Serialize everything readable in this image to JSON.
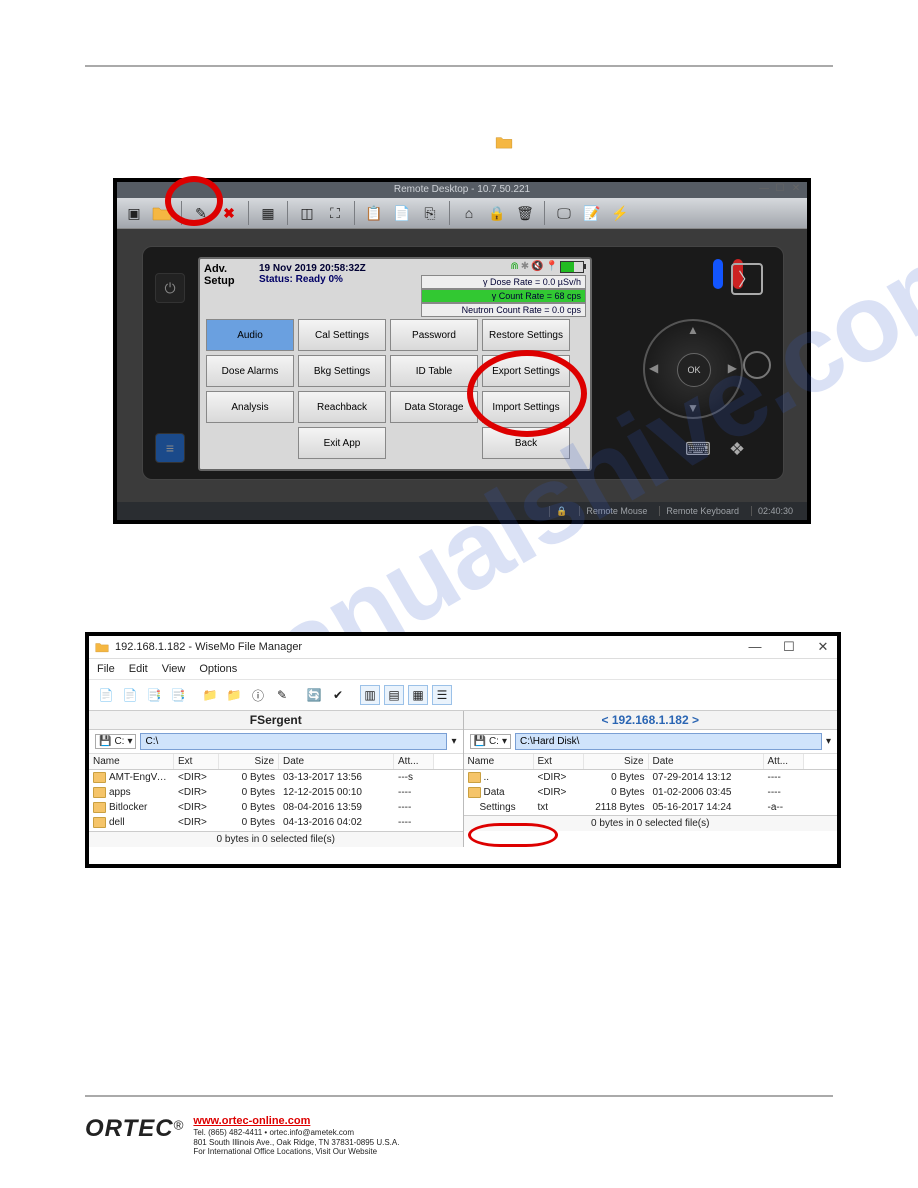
{
  "remote_desktop": {
    "title": "Remote Desktop - 10.7.50.221",
    "footer": {
      "mouse": "Remote Mouse",
      "keyboard": "Remote Keyboard",
      "time": "02:40:30"
    },
    "device": {
      "header": {
        "title_l1": "Adv.",
        "title_l2": "Setup",
        "timestamp": "19 Nov 2019 20:58:32Z",
        "status": "Status: Ready 0%"
      },
      "rates": {
        "dose": "γ Dose Rate = 0.0  µSv/h",
        "count": "γ Count Rate = 68 cps",
        "neutron": "Neutron Count Rate = 0.0 cps"
      },
      "buttons": {
        "audio": "Audio",
        "cal": "Cal Settings",
        "password": "Password",
        "restore": "Restore Settings",
        "dose_alarms": "Dose Alarms",
        "bkg": "Bkg Settings",
        "idtable": "ID Table",
        "export": "Export Settings",
        "analysis": "Analysis",
        "reachback": "Reachback",
        "storage": "Data Storage",
        "import": "Import Settings",
        "exit": "Exit App",
        "back": "Back"
      },
      "dpad_ok": "OK"
    }
  },
  "file_manager": {
    "title": "192.168.1.182 - WiseMo File Manager",
    "menu": {
      "file": "File",
      "edit": "Edit",
      "view": "View",
      "options": "Options"
    },
    "window_btns": {
      "min": "—",
      "max": "☐",
      "close": "✕"
    },
    "columns": {
      "name": "Name",
      "ext": "Ext",
      "size": "Size",
      "date": "Date",
      "att": "Att..."
    },
    "left": {
      "header": "FSergent",
      "drive": "C:",
      "path": "C:\\",
      "rows": [
        {
          "name": "AMT-EngVa...",
          "ext": "<DIR>",
          "size": "0 Bytes",
          "date": "03-13-2017 13:56",
          "att": "---s"
        },
        {
          "name": "apps",
          "ext": "<DIR>",
          "size": "0 Bytes",
          "date": "12-12-2015 00:10",
          "att": "----"
        },
        {
          "name": "Bitlocker",
          "ext": "<DIR>",
          "size": "0 Bytes",
          "date": "08-04-2016 13:59",
          "att": "----"
        },
        {
          "name": "dell",
          "ext": "<DIR>",
          "size": "0 Bytes",
          "date": "04-13-2016 04:02",
          "att": "----"
        }
      ],
      "status": "0 bytes in 0 selected file(s)"
    },
    "right": {
      "header": "< 192.168.1.182 >",
      "drive": "C:",
      "path": "C:\\Hard Disk\\",
      "rows": [
        {
          "name": "..",
          "ext": "<DIR>",
          "size": "0 Bytes",
          "date": "07-29-2014 13:12",
          "att": "----"
        },
        {
          "name": "Data",
          "ext": "<DIR>",
          "size": "0 Bytes",
          "date": "01-02-2006 03:45",
          "att": "----"
        },
        {
          "name": "Settings",
          "ext": "txt",
          "size": "2118 Bytes",
          "date": "05-16-2017 14:24",
          "att": "-a--"
        }
      ],
      "status": "0 bytes in 0 selected file(s)"
    }
  },
  "footer": {
    "brand": "ORTEC",
    "reg": "®",
    "url": "www.ortec-online.com",
    "line1": "Tel. (865) 482-4411 • ortec.info@ametek.com",
    "line2": "801 South Illinois Ave., Oak Ridge, TN 37831-0895 U.S.A.",
    "line3": "For International Office Locations, Visit Our Website"
  }
}
